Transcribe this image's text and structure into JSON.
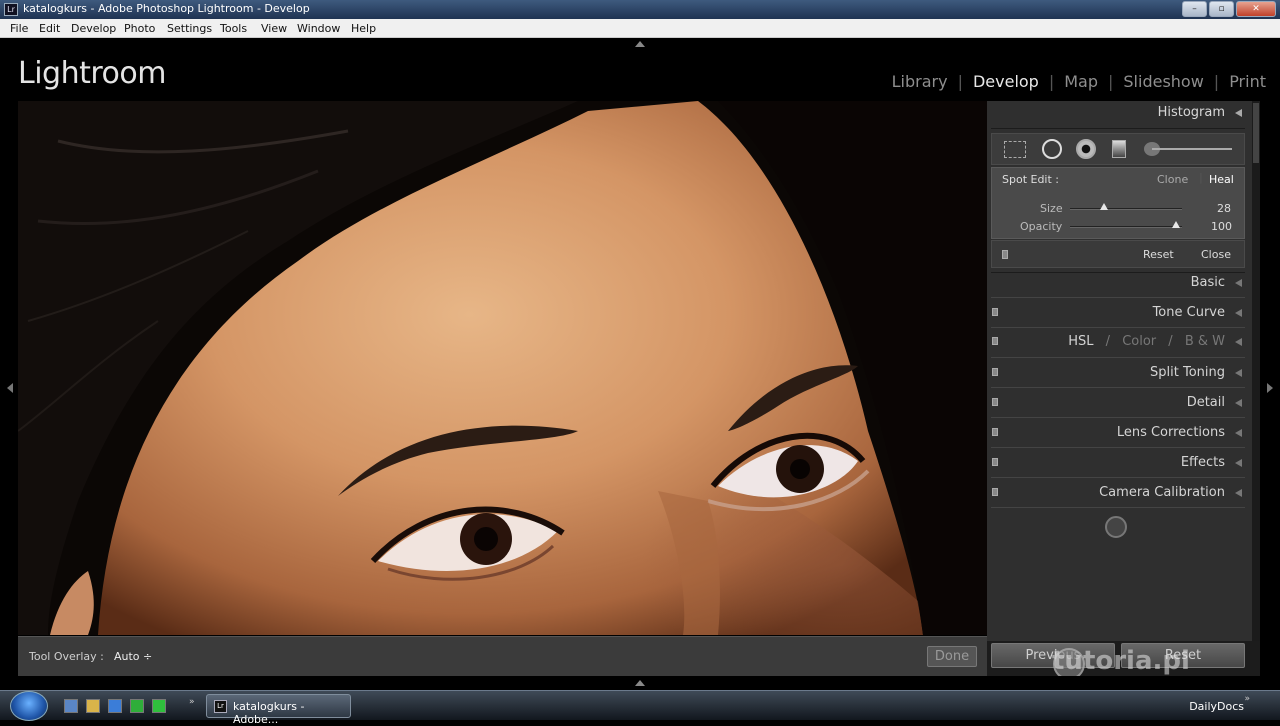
{
  "window": {
    "title": "katalogkurs - Adobe Photoshop Lightroom - Develop",
    "app_icon": "Lr",
    "buttons": {
      "minimize": "–",
      "maximize": "▫",
      "close": "✕"
    }
  },
  "menu": [
    "File",
    "Edit",
    "Develop",
    "Photo",
    "Settings",
    "Tools",
    "View",
    "Window",
    "Help"
  ],
  "lightroom": {
    "logo": "Lightroom",
    "modules": [
      "Library",
      "Develop",
      "Map",
      "Slideshow",
      "Print"
    ],
    "active_module": "Develop"
  },
  "toolbar": {
    "overlay_label": "Tool Overlay :",
    "overlay_value": "Auto ÷",
    "done_label": "Done"
  },
  "right_panel": {
    "histogram_label": "Histogram",
    "spot": {
      "label": "Spot Edit :",
      "mode_clone": "Clone",
      "mode_heal": "Heal",
      "active_mode": "Heal",
      "size_label": "Size",
      "size_value": "28",
      "size_fraction": 0.3,
      "opacity_label": "Opacity",
      "opacity_value": "100",
      "opacity_fraction": 0.95,
      "reset_label": "Reset",
      "close_label": "Close"
    },
    "sections": {
      "basic": "Basic",
      "tone_curve": "Tone Curve",
      "hsl": "HSL",
      "color": "Color",
      "bw": "B & W",
      "hsl_sep": "/",
      "split_toning": "Split Toning",
      "detail": "Detail",
      "lens_corrections": "Lens Corrections",
      "effects": "Effects",
      "camera_calibration": "Camera Calibration"
    },
    "previous_label": "Previous",
    "reset_label": "Reset"
  },
  "watermark": "tutoria.pl",
  "taskbar": {
    "task_title": "katalogkurs - Adobe...",
    "task_icon": "Lr",
    "tray_label": "DailyDocs",
    "tray_arrow": "»"
  }
}
